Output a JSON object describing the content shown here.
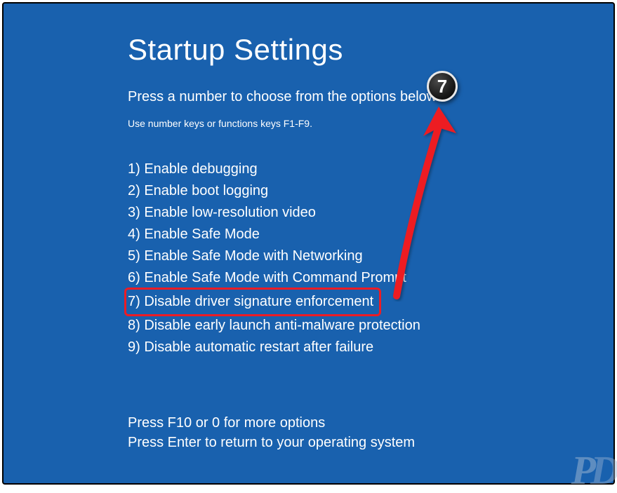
{
  "title": "Startup Settings",
  "subtitle": "Press a number to choose from the options below:",
  "hint": "Use number keys or functions keys F1-F9.",
  "options": [
    "1) Enable debugging",
    "2) Enable boot logging",
    "3) Enable low-resolution video",
    "4) Enable Safe Mode",
    "5) Enable Safe Mode with Networking",
    "6) Enable Safe Mode with Command Prompt",
    "7) Disable driver signature enforcement",
    "8) Disable early launch anti-malware protection",
    "9) Disable automatic restart after failure"
  ],
  "footer1": "Press F10 or 0 for more options",
  "footer2": "Press Enter to return to your operating system",
  "badge_number": "7",
  "highlighted_index": 6,
  "colors": {
    "background": "#1961ae",
    "highlight_border": "#ed1c24",
    "arrow": "#ed1c24"
  }
}
